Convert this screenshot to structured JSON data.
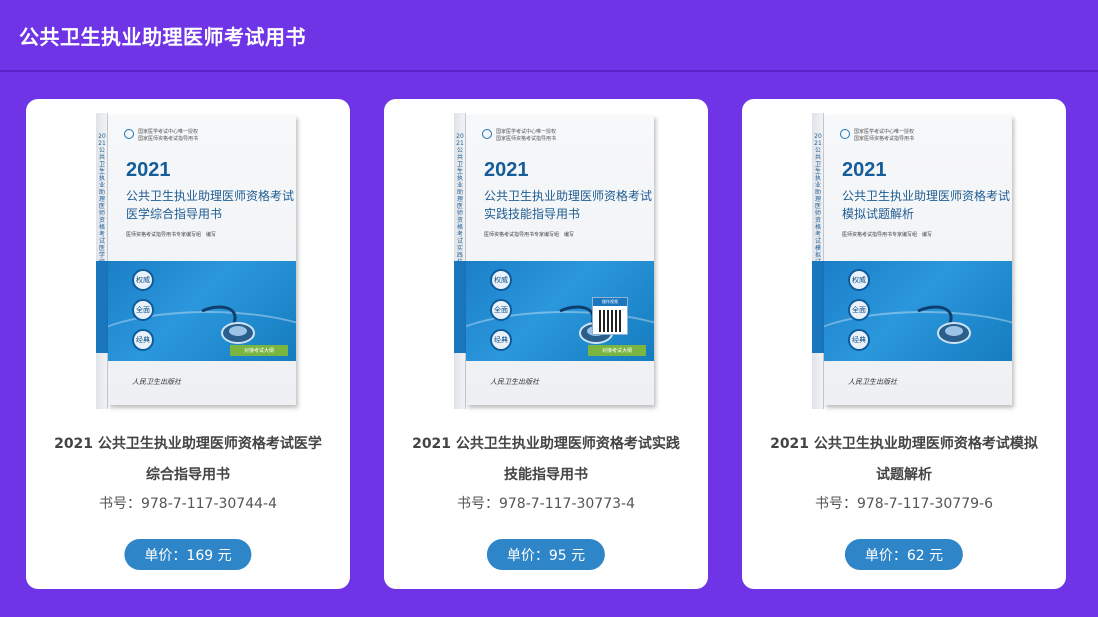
{
  "header": {
    "title": "公共卫生执业助理医师考试用书"
  },
  "books": [
    {
      "title": "2021 公共卫生执业助理医师资格考试医学综合指导用书",
      "isbn": "书号：978-7-117-30744-4",
      "price": "单价：169 元",
      "cover": {
        "pub_line1": "国家医学考试中心唯一授权",
        "pub_line2": "国家医师资格考试指导用书",
        "year": "2021",
        "title1": "公共卫生执业助理医师资格考试",
        "title2": "医学综合指导用书",
        "editor": "医师资格考试指导用书专家编写组　编写",
        "badges": [
          "权威",
          "全面",
          "经典"
        ],
        "tag": "对接考试大纲",
        "qr": null,
        "publisher": "人民卫生出版社",
        "spine": "2021公共卫生执业助理医师资格考试医学综合指导用书"
      }
    },
    {
      "title": "2021 公共卫生执业助理医师资格考试实践技能指导用书",
      "isbn": "书号：978-7-117-30773-4",
      "price": "单价：95 元",
      "cover": {
        "pub_line1": "国家医学考试中心唯一授权",
        "pub_line2": "国家医师资格考试指导用书",
        "year": "2021",
        "title1": "公共卫生执业助理医师资格考试",
        "title2": "实践技能指导用书",
        "editor": "医师资格考试指导用书专家编写组　编写",
        "badges": [
          "权威",
          "全面",
          "经典"
        ],
        "tag": "对接考试大纲",
        "qr": "操作视频",
        "publisher": "人民卫生出版社",
        "spine": "2021公共卫生执业助理医师资格考试实践技能指导用书"
      }
    },
    {
      "title": "2021 公共卫生执业助理医师资格考试模拟试题解析",
      "isbn": "书号：978-7-117-30779-6",
      "price": "单价：62 元",
      "cover": {
        "pub_line1": "国家医学考试中心唯一授权",
        "pub_line2": "国家医师资格考试指导用书",
        "year": "2021",
        "title1": "公共卫生执业助理医师资格考试",
        "title2": "模拟试题解析",
        "editor": "医师资格考试指导用书专家编写组　编写",
        "badges": [
          "权威",
          "全面",
          "经典"
        ],
        "tag": null,
        "qr": null,
        "publisher": "人民卫生出版社",
        "spine": "2021公共卫生执业助理医师资格考试模拟试题解析"
      }
    }
  ],
  "colors": {
    "background": "#6f34e6",
    "card": "#ffffff",
    "price_button": "#2e86c8",
    "cover_blue": "#1a76bd"
  }
}
